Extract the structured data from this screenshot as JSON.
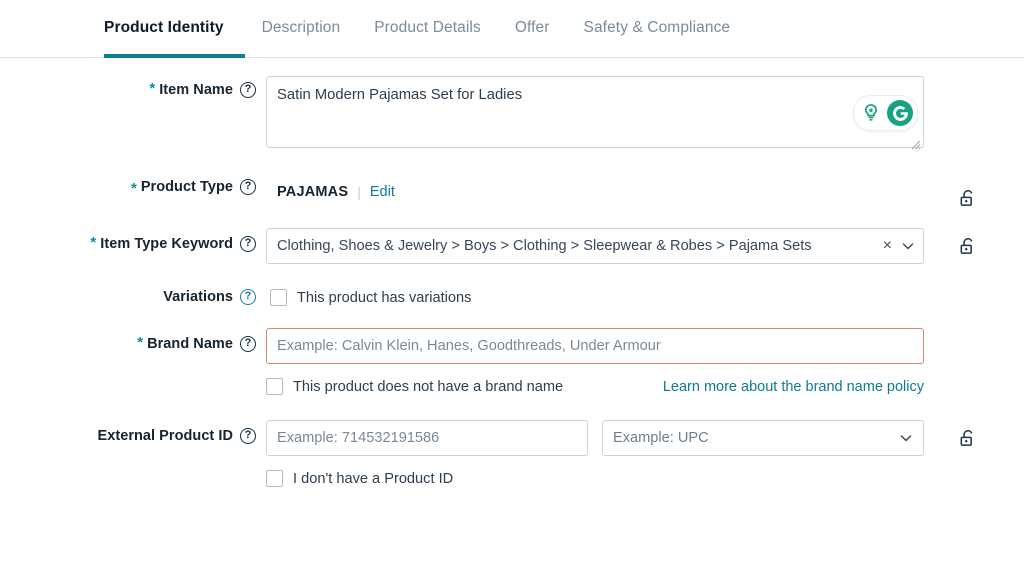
{
  "tabs": [
    {
      "label": "Product Identity",
      "active": true
    },
    {
      "label": "Description",
      "active": false
    },
    {
      "label": "Product Details",
      "active": false
    },
    {
      "label": "Offer",
      "active": false
    },
    {
      "label": "Safety & Compliance",
      "active": false
    }
  ],
  "colors": {
    "accent_teal": "#0b7e94",
    "link_teal": "#0e7b93",
    "required_asterisk": "#0d8ba1",
    "error_border": "#d98576",
    "grammarly_green": "#15a37f",
    "text_dark": "#16242f"
  },
  "fields": {
    "item_name": {
      "label": "Item Name",
      "required": true,
      "help": "?",
      "value": "Satin Modern Pajamas Set for Ladies",
      "assistant_icons": [
        "lightbulb-icon",
        "grammarly-icon"
      ]
    },
    "product_type": {
      "label": "Product Type",
      "required": true,
      "help": "?",
      "value": "PAJAMAS",
      "separator": "|",
      "edit_label": "Edit",
      "locked": false
    },
    "item_type_keyword": {
      "label": "Item Type Keyword",
      "required": true,
      "help": "?",
      "value": "Clothing, Shoes & Jewelry > Boys > Clothing > Sleepwear & Robes > Pajama Sets",
      "clear_label": "×",
      "locked": false
    },
    "variations": {
      "label": "Variations",
      "required": false,
      "help": "?",
      "checkbox_label": "This product has variations",
      "checked": false
    },
    "brand_name": {
      "label": "Brand Name",
      "required": true,
      "help": "?",
      "value": "",
      "placeholder": "Example: Calvin Klein, Hanes, Goodthreads, Under Armour",
      "has_error": true,
      "checkbox_label": "This product does not have a brand name",
      "checked": false,
      "policy_link": "Learn more about the brand name policy"
    },
    "external_product_id": {
      "label": "External Product ID",
      "required": false,
      "help": "?",
      "value": "",
      "placeholder": "Example: 714532191586",
      "type_value": "Example: UPC",
      "checkbox_label": "I don't have a Product ID",
      "checked": false,
      "locked": false
    }
  }
}
